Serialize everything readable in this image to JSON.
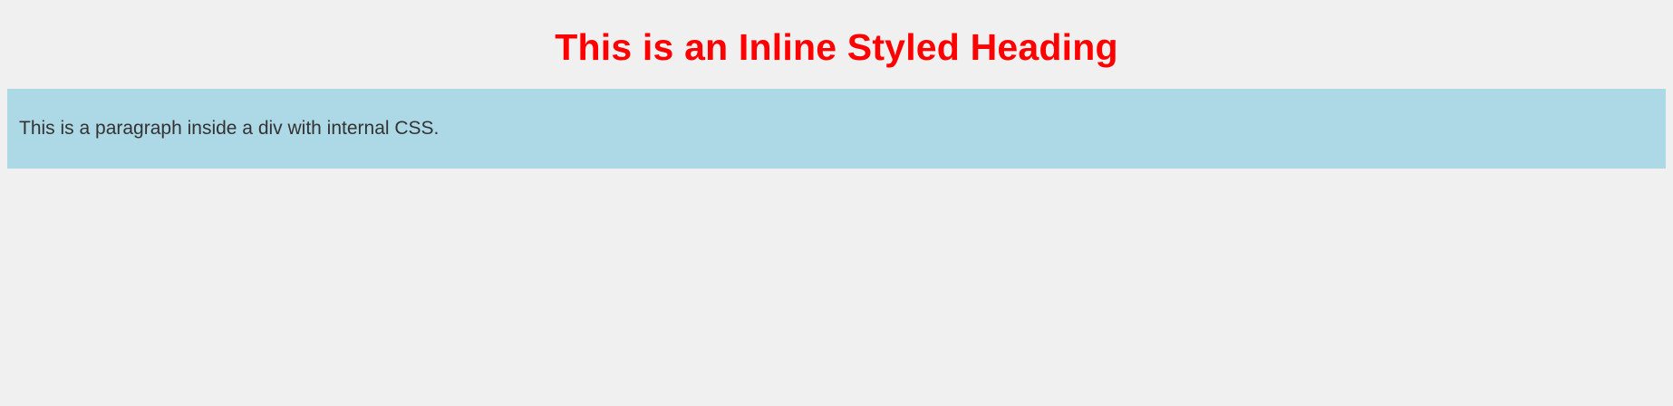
{
  "heading": {
    "text": "This is an Inline Styled Heading",
    "color": "#ff0000"
  },
  "content_box": {
    "paragraph": "This is a paragraph inside a div with internal CSS.",
    "background": "#add8e6",
    "text_color": "#333333"
  },
  "page": {
    "background": "#f0f0f0"
  }
}
